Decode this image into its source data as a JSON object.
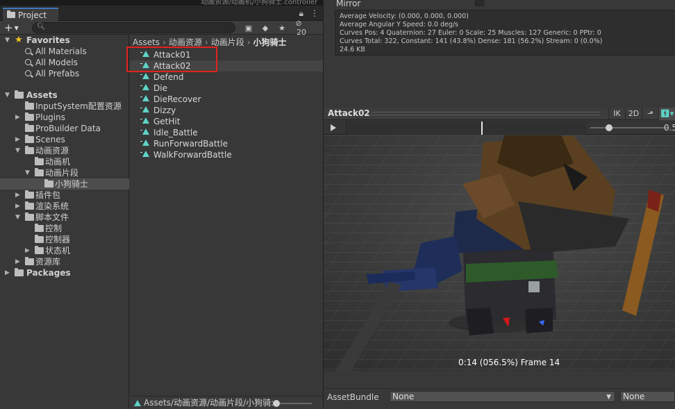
{
  "window": {
    "path_title": "动画资源/动画机/小狗骑士.controller"
  },
  "project": {
    "tab_label": "Project",
    "add_label": "+",
    "search": {
      "placeholder": "",
      "value": ""
    },
    "hidden_count": "20",
    "tree": {
      "favorites_label": "Favorites",
      "favorites": [
        "All Materials",
        "All Models",
        "All Prefabs"
      ],
      "assets_label": "Assets",
      "assets": {
        "inputsystem": "InputSystem配置资源",
        "plugins": "Plugins",
        "probuilder": "ProBuilder Data",
        "scenes": "Scenes",
        "anim_res": "动画资源",
        "anim_machine": "动画机",
        "anim_clips": "动画片段",
        "puppy_knight": "小狗骑士",
        "addon": "插件包",
        "render": "渲染系统",
        "scripts": "脚本文件",
        "control": "控制",
        "controller": "控制器",
        "state_machine": "状态机",
        "library": "资源库"
      },
      "packages_label": "Packages"
    },
    "breadcrumb": [
      "Assets",
      "动画资源",
      "动画片段",
      "小狗骑士"
    ],
    "files": [
      "Attack01",
      "Attack02",
      "Defend",
      "Die",
      "DieRecover",
      "Dizzy",
      "GetHit",
      "Idle_Battle",
      "RunForwardBattle",
      "WalkForwardBattle"
    ],
    "status_path": "Assets/动画资源/动画片段/小狗骑:"
  },
  "inspector": {
    "mirror_label": "Mirror",
    "mirror_checked": false,
    "info_lines": [
      "Average Velocity: (0.000, 0.000, 0.000)",
      "Average Angular Y Speed: 0.0 deg/s",
      "Curves Pos: 4 Quaternion: 27 Euler: 0 Scale: 25 Muscles: 127 Generic: 0 PPtr: 0",
      "Curves Total: 322, Constant: 141 (43.8%) Dense: 181 (56.2%) Stream: 0 (0.0%)",
      "24.6 KB"
    ],
    "preview": {
      "title": "Attack02",
      "ik": "IK",
      "two_d": "2D",
      "speed": "0.5",
      "playhead_fraction": 0.565,
      "frame_text": "0:14 (056.5%) Frame 14"
    },
    "asset_bundle": {
      "label": "AssetBundle",
      "name": "None",
      "variant": "None"
    }
  },
  "colors": {
    "accent": "#3a79bb",
    "highlight_box": "#e2231a",
    "clip_icon": "#5fd3c8",
    "favorite_star": "#f0c419"
  }
}
